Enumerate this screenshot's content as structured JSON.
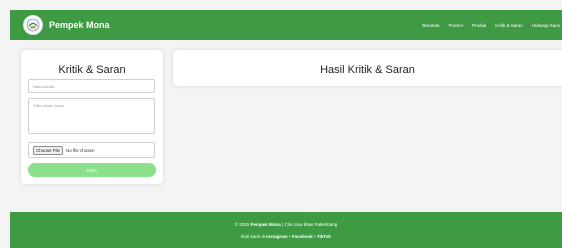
{
  "navbar": {
    "brand": "Pempek Mona",
    "logo_icon": "pempek-logo-icon",
    "links": [
      "Beranda",
      "Promo!",
      "Produk",
      "Kritik & Saran",
      "Hubungi Kami"
    ]
  },
  "form": {
    "title": "Kritik & Saran",
    "name_placeholder": "Nama Anda",
    "message_placeholder": "Tulis pesan Anda",
    "file_button": "Choose File",
    "file_status": "No file chosen",
    "submit_label": "Kirim"
  },
  "results": {
    "title": "Hasil Kritik & Saran"
  },
  "footer": {
    "copyright_prefix": "© 2025",
    "brand": "Pempek Mona",
    "copyright_suffix": "| Cita rasa khas Palembang",
    "follow_prefix": "Ikuti kami di",
    "social": [
      "Instagram",
      "Facebook",
      "TikTok"
    ],
    "social_separator": "•"
  },
  "colors": {
    "primary_green": "#3e9a43",
    "button_green": "#8be08b",
    "background": "#f4f4f4"
  }
}
